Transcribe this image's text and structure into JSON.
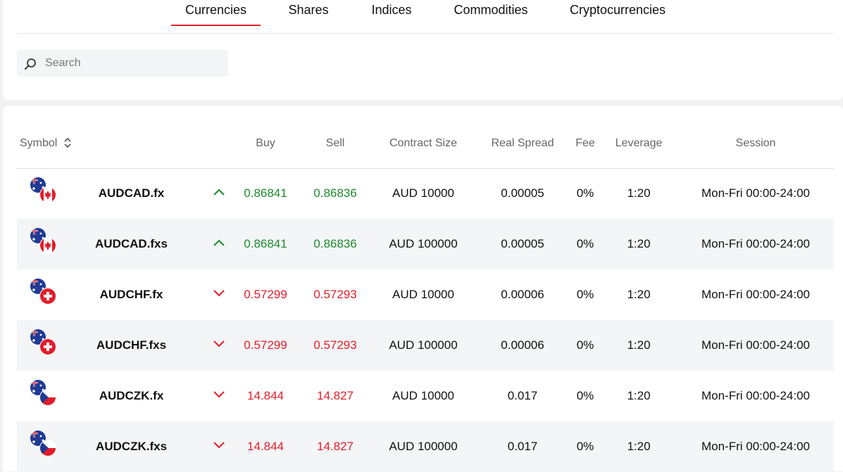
{
  "tabs": [
    {
      "label": "Currencies",
      "active": true
    },
    {
      "label": "Shares",
      "active": false
    },
    {
      "label": "Indices",
      "active": false
    },
    {
      "label": "Commodities",
      "active": false
    },
    {
      "label": "Cryptocurrencies",
      "active": false
    }
  ],
  "search": {
    "placeholder": "Search",
    "value": ""
  },
  "colors": {
    "accent": "#e11d2a",
    "up": "#1d8a2e",
    "down": "#e11d2a"
  },
  "columns": {
    "symbol": "Symbol",
    "buy": "Buy",
    "sell": "Sell",
    "contract_size": "Contract Size",
    "real_spread": "Real Spread",
    "fee": "Fee",
    "leverage": "Leverage",
    "session": "Session"
  },
  "rows": [
    {
      "symbol": "AUDCAD.fx",
      "direction": "up",
      "buy": "0.86841",
      "sell": "0.86836",
      "contract_size": "AUD 10000",
      "real_spread": "0.00005",
      "fee": "0%",
      "leverage": "1:20",
      "session": "Mon-Fri 00:00-24:00",
      "quote_flag": "canada"
    },
    {
      "symbol": "AUDCAD.fxs",
      "direction": "up",
      "buy": "0.86841",
      "sell": "0.86836",
      "contract_size": "AUD 100000",
      "real_spread": "0.00005",
      "fee": "0%",
      "leverage": "1:20",
      "session": "Mon-Fri 00:00-24:00",
      "quote_flag": "canada"
    },
    {
      "symbol": "AUDCHF.fx",
      "direction": "down",
      "buy": "0.57299",
      "sell": "0.57293",
      "contract_size": "AUD 10000",
      "real_spread": "0.00006",
      "fee": "0%",
      "leverage": "1:20",
      "session": "Mon-Fri 00:00-24:00",
      "quote_flag": "switzerland"
    },
    {
      "symbol": "AUDCHF.fxs",
      "direction": "down",
      "buy": "0.57299",
      "sell": "0.57293",
      "contract_size": "AUD 100000",
      "real_spread": "0.00006",
      "fee": "0%",
      "leverage": "1:20",
      "session": "Mon-Fri 00:00-24:00",
      "quote_flag": "switzerland"
    },
    {
      "symbol": "AUDCZK.fx",
      "direction": "down",
      "buy": "14.844",
      "sell": "14.827",
      "contract_size": "AUD 10000",
      "real_spread": "0.017",
      "fee": "0%",
      "leverage": "1:20",
      "session": "Mon-Fri 00:00-24:00",
      "quote_flag": "czechia"
    },
    {
      "symbol": "AUDCZK.fxs",
      "direction": "down",
      "buy": "14.844",
      "sell": "14.827",
      "contract_size": "AUD 100000",
      "real_spread": "0.017",
      "fee": "0%",
      "leverage": "1:20",
      "session": "Mon-Fri 00:00-24:00",
      "quote_flag": "czechia"
    }
  ]
}
